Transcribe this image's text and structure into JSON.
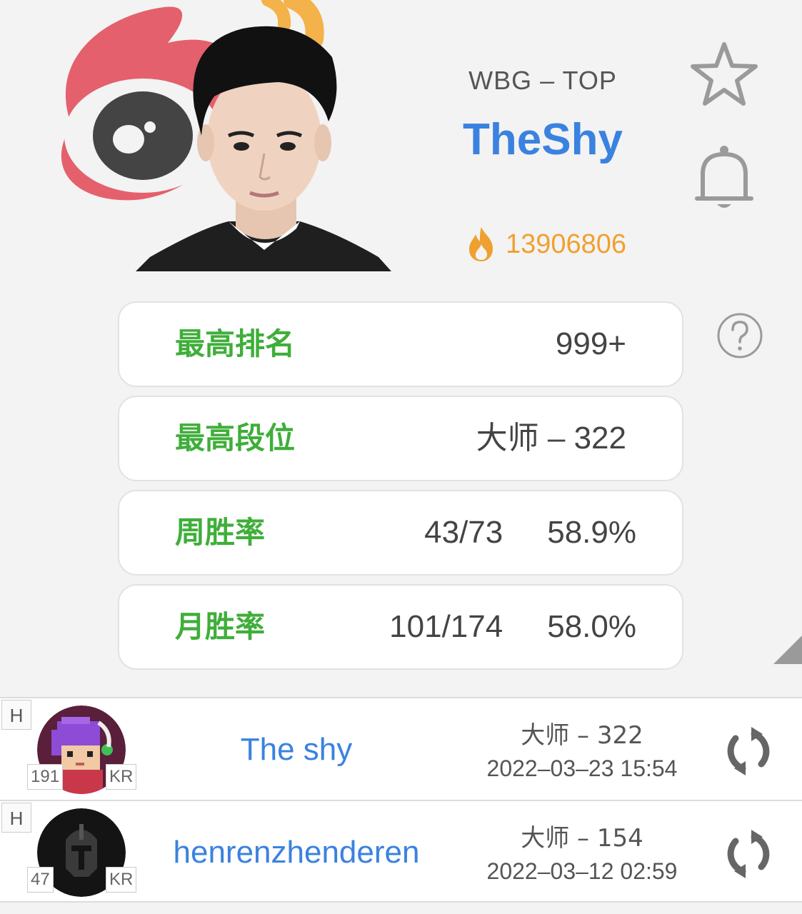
{
  "header": {
    "team_role": "WBG – TOP",
    "player_name": "TheShy",
    "heat_value": "13906806"
  },
  "icons": {
    "logo": "weibo-logo",
    "favorite": "star-icon",
    "subscribe": "bell-icon",
    "help": "question-circle-icon",
    "heat": "flame-icon",
    "refresh": "refresh-icon"
  },
  "stats": [
    {
      "label": "最高排名",
      "value": "999+"
    },
    {
      "label": "最高段位",
      "value": "大师 – 322"
    },
    {
      "label": "周胜率",
      "record": "43/73",
      "rate": "58.9%"
    },
    {
      "label": "月胜率",
      "record": "101/174",
      "rate": "58.0%"
    }
  ],
  "accounts": [
    {
      "tag": "H",
      "level": "191",
      "region": "KR",
      "name": "The shy",
      "rank": "大师 – 322",
      "time": "2022–03–23 15:54"
    },
    {
      "tag": "H",
      "level": "47",
      "region": "KR",
      "name": "henrenzhenderen",
      "rank": "大师 – 154",
      "time": "2022–03–12 02:59"
    }
  ],
  "colors": {
    "accent_blue": "#3a82e0",
    "label_green": "#3fae3a",
    "heat_orange": "#f0a030",
    "weibo_red": "#e4606d"
  }
}
